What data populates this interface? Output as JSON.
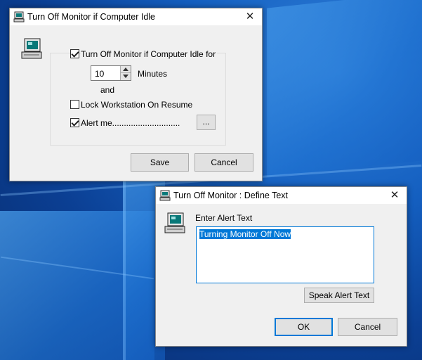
{
  "main_window": {
    "title": "Turn Off Monitor if Computer Idle",
    "close_glyph": "✕",
    "turn_off_label": "Turn Off Monitor if Computer Idle for",
    "turn_off_checked": true,
    "minutes_value": "10",
    "minutes_label": "Minutes",
    "and_label": "and",
    "lock_label": "Lock Workstation On Resume",
    "lock_checked": false,
    "alert_label": "Alert me.............................",
    "alert_checked": true,
    "browse_label": "...",
    "save_label": "Save",
    "cancel_label": "Cancel"
  },
  "define_window": {
    "title": "Turn Off Monitor : Define Text",
    "close_glyph": "✕",
    "prompt_label": "Enter Alert Text",
    "alert_text": "Turning Monitor Off Now",
    "speak_label": "Speak Alert Text",
    "ok_label": "OK",
    "cancel_label": "Cancel"
  },
  "icons": {
    "app": "computer-monitor-icon"
  }
}
